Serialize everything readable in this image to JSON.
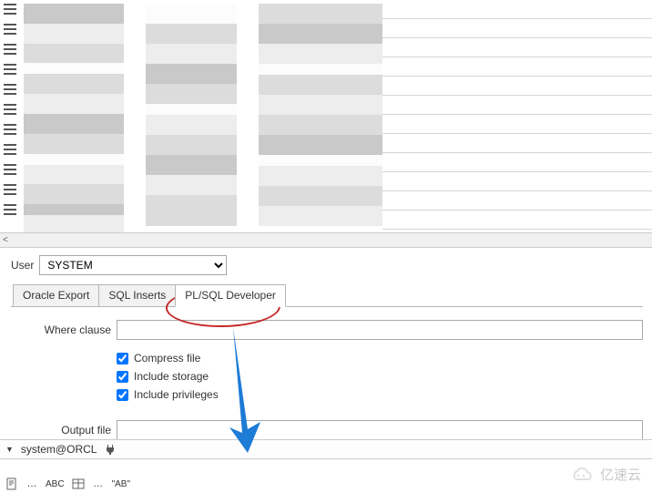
{
  "user": {
    "label": "User",
    "value": "SYSTEM"
  },
  "tabs": [
    {
      "label": "Oracle Export",
      "active": false
    },
    {
      "label": "SQL Inserts",
      "active": false
    },
    {
      "label": "PL/SQL Developer",
      "active": true
    }
  ],
  "panel": {
    "where_label": "Where clause",
    "where_value": "",
    "output_label": "Output file",
    "output_value": "",
    "checks": [
      {
        "label": "Compress file",
        "checked": true
      },
      {
        "label": "Include storage",
        "checked": true
      },
      {
        "label": "Include privileges",
        "checked": true
      }
    ]
  },
  "status": {
    "connection": "system@ORCL"
  },
  "bottombar": {
    "text1": "ABC",
    "text2": "\"AB\""
  },
  "watermark": "亿速云"
}
